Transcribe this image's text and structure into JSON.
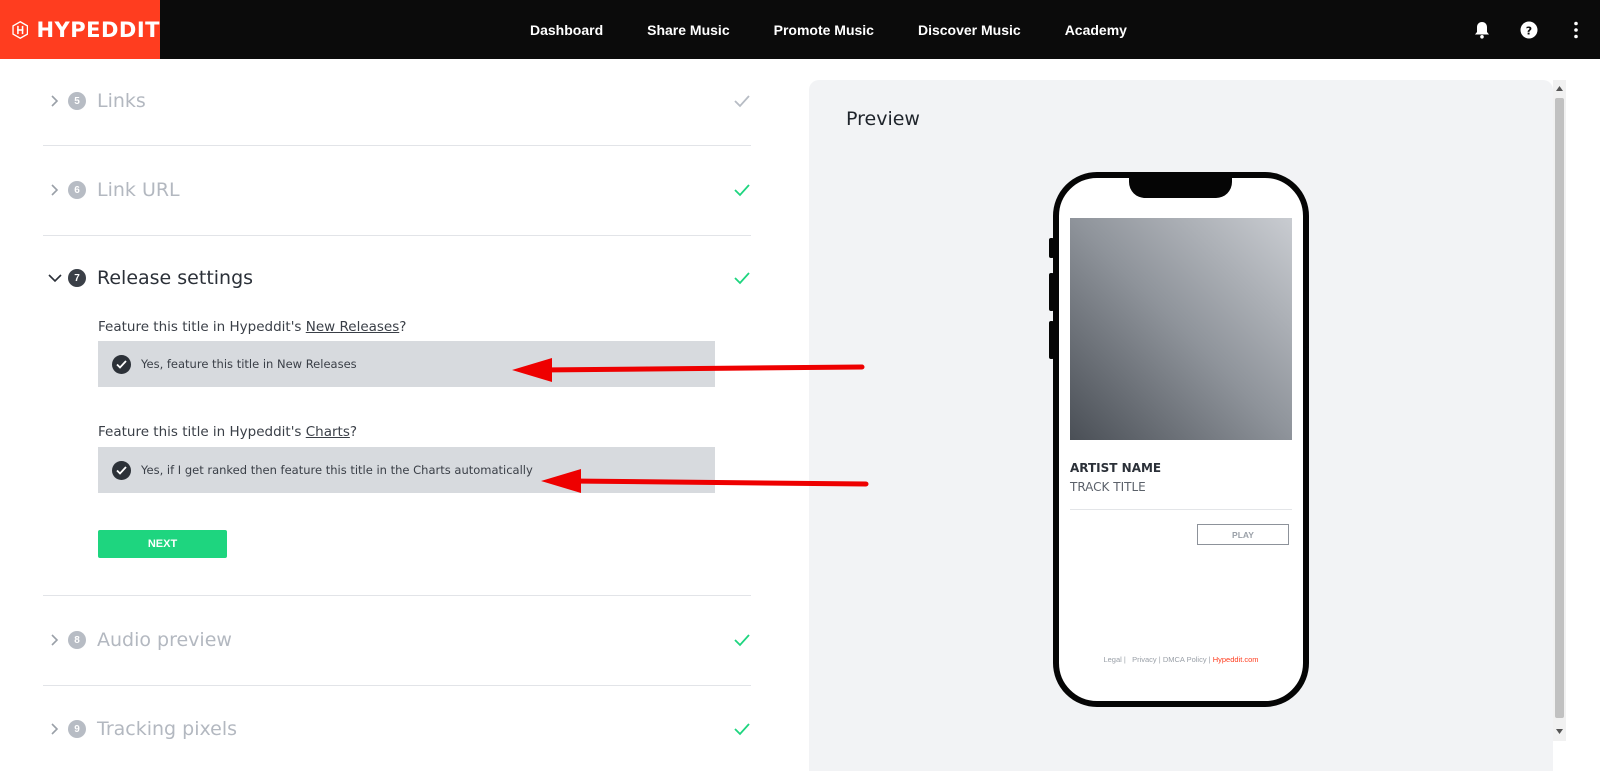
{
  "brand": {
    "name": "HYPEDDIT",
    "color": "#ff3d1f"
  },
  "nav": {
    "items": [
      {
        "label": "Dashboard"
      },
      {
        "label": "Share Music"
      },
      {
        "label": "Promote Music"
      },
      {
        "label": "Discover Music"
      },
      {
        "label": "Academy"
      }
    ],
    "icons": [
      "bell-icon",
      "help-icon",
      "more-vertical-icon"
    ]
  },
  "steps": [
    {
      "number": "5",
      "title": "Links",
      "state": "collapsed",
      "check_color": "#b7bcc4"
    },
    {
      "number": "6",
      "title": "Link URL",
      "state": "collapsed",
      "check_color": "#1ed57f"
    },
    {
      "number": "7",
      "title": "Release settings",
      "state": "expanded",
      "check_color": "#1ed57f"
    },
    {
      "number": "8",
      "title": "Audio preview",
      "state": "collapsed",
      "check_color": "#1ed57f"
    },
    {
      "number": "9",
      "title": "Tracking pixels",
      "state": "collapsed",
      "check_color": "#1ed57f"
    }
  ],
  "release_settings": {
    "q1_prefix": "Feature this title in Hypeddit's ",
    "q1_link": "New Releases",
    "q1_suffix": "?",
    "q1_option": "Yes, feature this title in New Releases",
    "q2_prefix": "Feature this title in Hypeddit's ",
    "q2_link": "Charts",
    "q2_suffix": "?",
    "q2_option": "Yes, if I get ranked then feature this title in the Charts automatically",
    "next_label": "NEXT"
  },
  "preview": {
    "title": "Preview",
    "artist": "ARTIST NAME",
    "track": "TRACK TITLE",
    "play_label": "PLAY",
    "footer": {
      "legal": "Legal |",
      "privacy": "Privacy |",
      "dmca": "DMCA Policy |",
      "site": "Hypeddit.com"
    }
  },
  "colors": {
    "accent_green": "#1ed57f",
    "annotation_red": "#ee0000"
  }
}
